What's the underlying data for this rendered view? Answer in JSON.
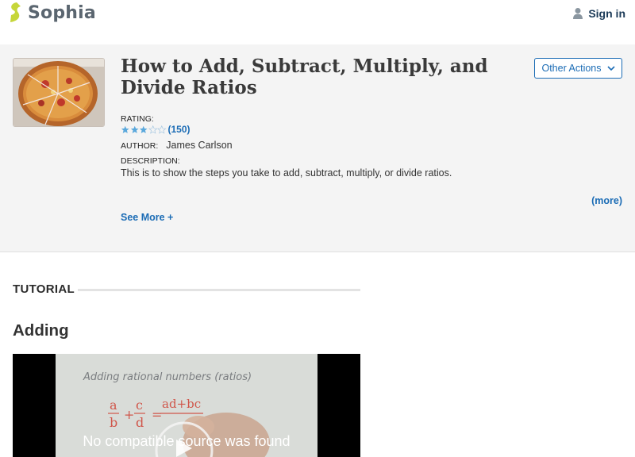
{
  "header": {
    "logo_text": "Sophia",
    "signin_label": "Sign in",
    "brand_color": "#c6d63a"
  },
  "resource": {
    "title": "How to Add, Subtract, Multiply, and Divide Ratios",
    "other_actions_label": "Other Actions",
    "rating_label": "RATING:",
    "rating_stars": 3,
    "rating_max": 5,
    "rating_count": "(150)",
    "author_label": "AUTHOR:",
    "author_name": "James Carlson",
    "description_label": "DESCRIPTION:",
    "description": "This is to show the steps you take to add, subtract, multiply, or divide ratios.",
    "more_label": "(more)",
    "see_more_label": "See More +"
  },
  "tutorial": {
    "heading": "TUTORIAL",
    "section_title": "Adding",
    "video_error": "No compatible source was found",
    "video_whiteboard_text": "Adding rational numbers (ratios)"
  },
  "colors": {
    "link": "#1b6cb5",
    "hero_bg": "#f4f4f4",
    "star_filled": "#5aa8dc"
  }
}
